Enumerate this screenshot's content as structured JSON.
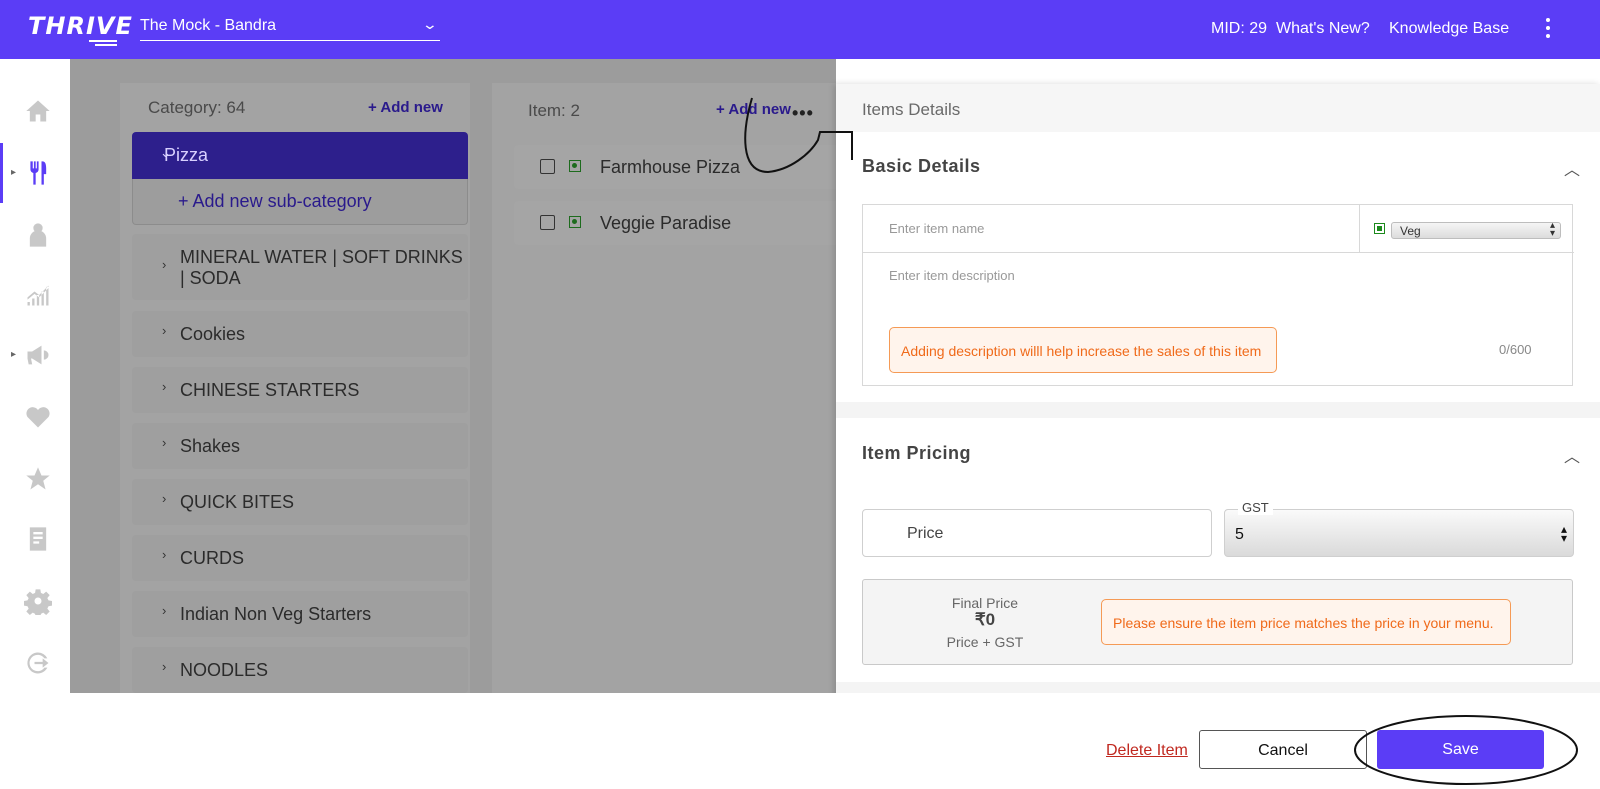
{
  "topbar": {
    "logo": "THRIVE",
    "outlet": "The Mock - Bandra",
    "mid": "MID: 29",
    "whats_new": "What's New?",
    "knowledge_base": "Knowledge Base"
  },
  "categories": {
    "header": "Category: 64",
    "add_new": "+ Add new",
    "active": "Pizza",
    "add_sub": "+ Add new sub-category",
    "rows": [
      "MINERAL WATER | SOFT DRINKS | SODA",
      "Cookies",
      "CHINESE STARTERS",
      "Shakes",
      "QUICK BITES",
      "CURDS",
      "Indian Non Veg Starters",
      "NOODLES"
    ]
  },
  "items": {
    "header": "Item: 2",
    "add_new": "+ Add new",
    "list": [
      "Farmhouse Pizza",
      "Veggie Paradise"
    ]
  },
  "drawer": {
    "title": "Items Details",
    "basic": {
      "title": "Basic Details",
      "name_placeholder": "Enter item name",
      "food_type": "Veg",
      "desc_placeholder": "Enter item description",
      "hint": "Adding description willl help increase the sales of this item",
      "count": "0/600"
    },
    "pricing": {
      "title": "Item Pricing",
      "price_placeholder": "Price",
      "gst_label": "GST",
      "gst_value": "5",
      "final_label": "Final Price",
      "final_value": "₹0",
      "final_sub": "Price + GST",
      "hint": "Please ensure the item price matches the price in your menu."
    }
  },
  "footer": {
    "delete": "Delete Item",
    "cancel": "Cancel",
    "save": "Save"
  },
  "colors": {
    "brand": "#5b3df6",
    "warning": "#f06a1a",
    "danger": "#c0281f"
  }
}
